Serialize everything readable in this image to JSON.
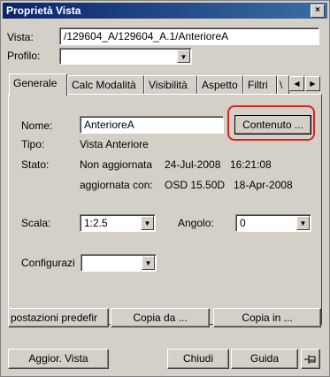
{
  "window": {
    "title": "Proprietà Vista",
    "close_label": "×"
  },
  "vista": {
    "label": "Vista:",
    "value": "/129604_A/129604_A.1/AnterioreA"
  },
  "profilo": {
    "label": "Profilo:",
    "value": ""
  },
  "tabs": [
    {
      "label": "Generale"
    },
    {
      "label": "Calc Modalità"
    },
    {
      "label": "Visibilità"
    },
    {
      "label": "Aspetto"
    },
    {
      "label": "Filtri"
    },
    {
      "label": "\\"
    }
  ],
  "tab_scroll": {
    "left": "◀",
    "right": "▶"
  },
  "general": {
    "nome_label": "Nome:",
    "nome_value": "AnterioreA",
    "contenuto_button": "Contenuto ...",
    "tipo_label": "Tipo:",
    "tipo_value": "Vista Anteriore",
    "stato_label": "Stato:",
    "stato_value": "Non aggiornata",
    "stato_date": "24-Jul-2008",
    "stato_time": "16:21:08",
    "aggiornata_label": "aggiornata con:",
    "aggiornata_value": "OSD 15.50D",
    "aggiornata_date": "18-Apr-2008",
    "scala_label": "Scala:",
    "scala_value": "1:2.5",
    "angolo_label": "Angolo:",
    "angolo_value": "0",
    "config_label": "Configurazi",
    "config_value": ""
  },
  "bottom_row1": {
    "impostazioni": "postazioni predefir",
    "copia_da": "Copia da ...",
    "copia_in": "Copia in ..."
  },
  "bottom_row2": {
    "aggior": "Aggior. Vista",
    "chiudi": "Chiudi",
    "guida": "Guida",
    "pin_icon": "pin-icon"
  },
  "colors": {
    "highlight": "#e0231e",
    "titlebar": "#0a246a"
  }
}
